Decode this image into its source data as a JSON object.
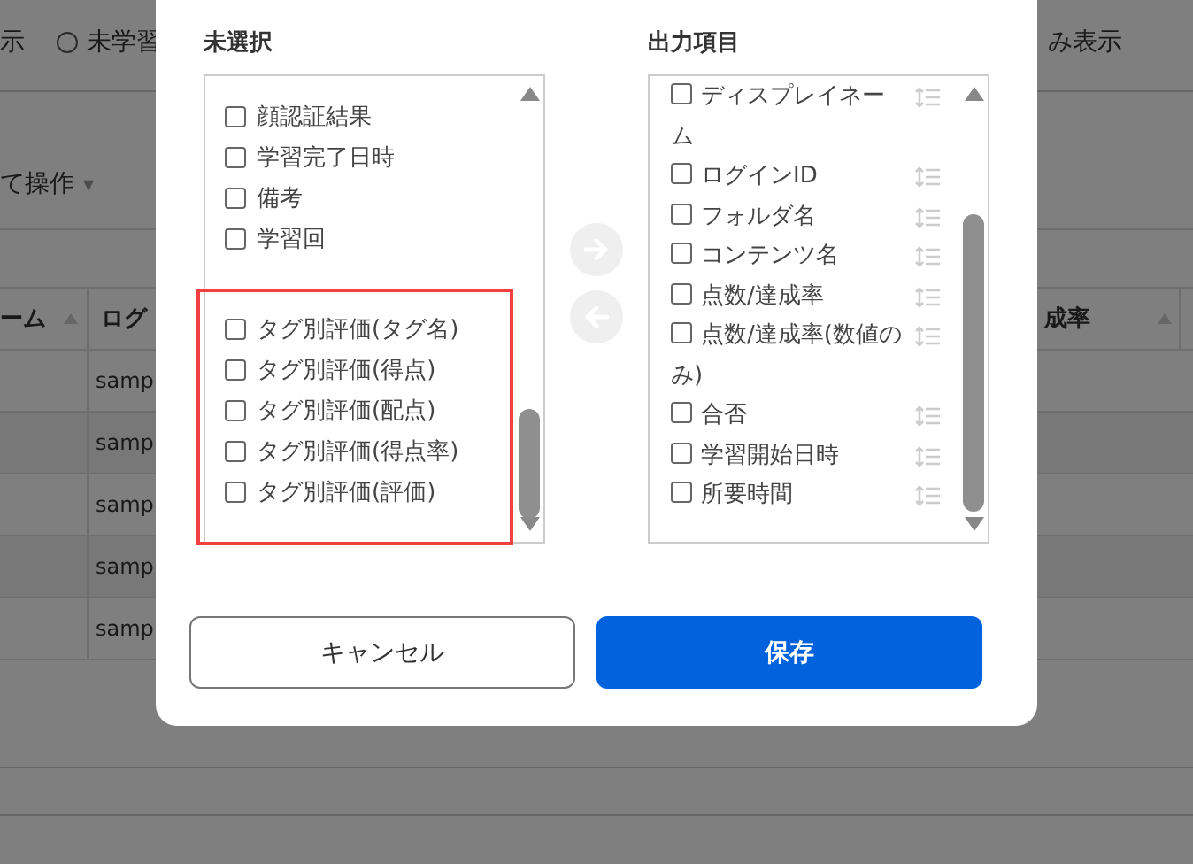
{
  "background": {
    "filter_left": "示",
    "radio_label": "未学習",
    "radio_selected": false,
    "filter_right": "み表示",
    "bulk_action": "て操作",
    "bulk_action_caret": "▾",
    "columns": [
      {
        "label": "ーム",
        "sortable": true
      },
      {
        "label": "ログ"
      },
      {
        "label": "成率",
        "sortable": true
      }
    ],
    "rows": [
      {
        "cell": "samp"
      },
      {
        "cell": "samp"
      },
      {
        "cell": "samp"
      },
      {
        "cell": "samp"
      },
      {
        "cell": "samp"
      }
    ]
  },
  "dialog": {
    "unselected": {
      "title": "未選択",
      "items": [
        {
          "label": "顔認証結果",
          "checked": false
        },
        {
          "label": "学習完了日時",
          "checked": false
        },
        {
          "label": "備考",
          "checked": false
        },
        {
          "label": "学習回",
          "checked": false
        }
      ],
      "highlighted_items": [
        {
          "label": "タグ別評価(タグ名)",
          "checked": false
        },
        {
          "label": "タグ別評価(得点)",
          "checked": false
        },
        {
          "label": "タグ別評価(配点)",
          "checked": false
        },
        {
          "label": "タグ別評価(得点率)",
          "checked": false
        },
        {
          "label": "タグ別評価(評価)",
          "checked": false
        }
      ]
    },
    "transfer_buttons": [
      {
        "kind": "right",
        "disabled": true
      },
      {
        "kind": "left",
        "disabled": true
      }
    ],
    "output": {
      "title": "出力項目",
      "items": [
        {
          "label": "ディスプレイネーム",
          "checked": false
        },
        {
          "label": "ログインID",
          "checked": false
        },
        {
          "label": "フォルダ名",
          "checked": false
        },
        {
          "label": "コンテンツ名",
          "checked": false
        },
        {
          "label": "点数/達成率",
          "checked": false
        },
        {
          "label": "点数/達成率(数値のみ)",
          "checked": false
        },
        {
          "label": "合否",
          "checked": false
        },
        {
          "label": "学習開始日時",
          "checked": false
        },
        {
          "label": "所要時間",
          "checked": false
        }
      ]
    },
    "buttons": [
      {
        "label": "キャンセル",
        "kind": "secondary"
      },
      {
        "label": "保存",
        "kind": "primary"
      }
    ]
  }
}
